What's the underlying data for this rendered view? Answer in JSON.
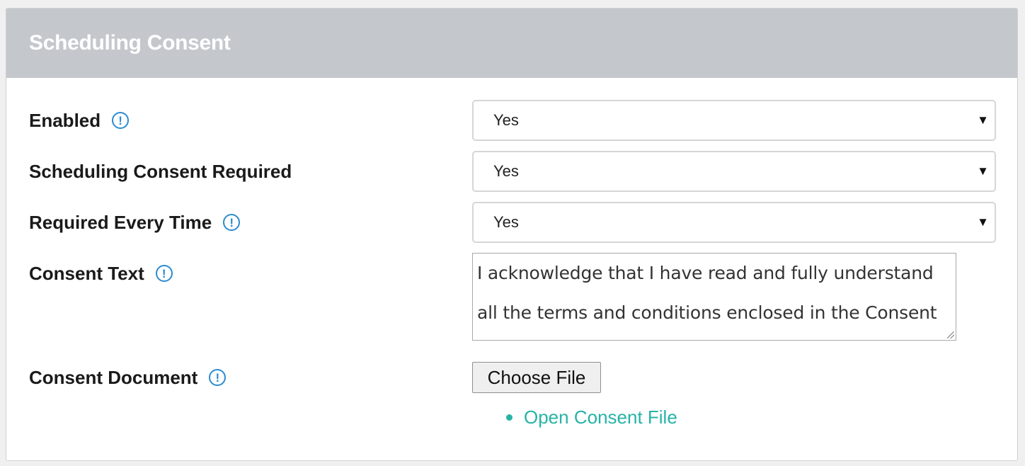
{
  "panel": {
    "title": "Scheduling Consent"
  },
  "fields": {
    "enabled": {
      "label": "Enabled",
      "value": "Yes"
    },
    "consent_required": {
      "label": "Scheduling Consent Required",
      "value": "Yes"
    },
    "required_every_time": {
      "label": "Required Every Time",
      "value": "Yes"
    },
    "consent_text": {
      "label": "Consent Text",
      "value": "I acknowledge that I have read and fully understand all the terms and conditions enclosed in the Consent Form."
    },
    "consent_document": {
      "label": "Consent Document",
      "button_label": "Choose File",
      "link_label": "Open Consent File"
    }
  },
  "icons": {
    "info": "!",
    "dropdown_arrow": "▼"
  },
  "colors": {
    "header_bg": "#c4c8cc",
    "info_icon": "#2b8bd0",
    "link": "#27b3a6"
  }
}
